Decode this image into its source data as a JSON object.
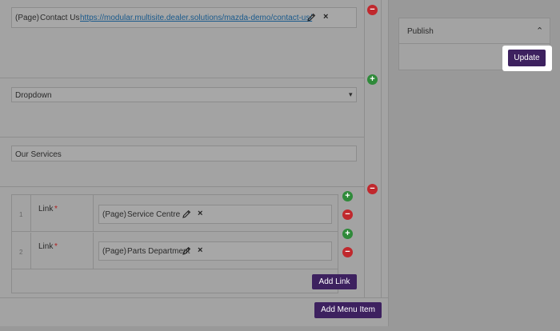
{
  "menu_items": {
    "first": {
      "type_tag": "(Page)",
      "title": "Contact Us",
      "url": "https://modular.multisite.dealer.solutions/mazda-demo/contact-us/"
    },
    "dropdown": {
      "selected": "Dropdown",
      "arrow": "▾"
    },
    "label_value": "Our Services",
    "sublinks": [
      {
        "index": "1",
        "label": "Link",
        "required": "*",
        "type_tag": "(Page)",
        "title": "Service Centre"
      },
      {
        "index": "2",
        "label": "Link",
        "required": "*",
        "type_tag": "(Page)",
        "title": "Parts Department"
      }
    ],
    "add_link_label": "Add Link",
    "add_menu_item_label": "Add Menu Item"
  },
  "icons": {
    "remove": "−",
    "add": "+",
    "close": "×",
    "collapse": "⌃"
  },
  "publish": {
    "title": "Publish",
    "update_label": "Update"
  },
  "colors": {
    "accent": "#3d215f",
    "remove": "#c0282d",
    "add": "#2f8a3a",
    "link": "#1a5a8c"
  }
}
